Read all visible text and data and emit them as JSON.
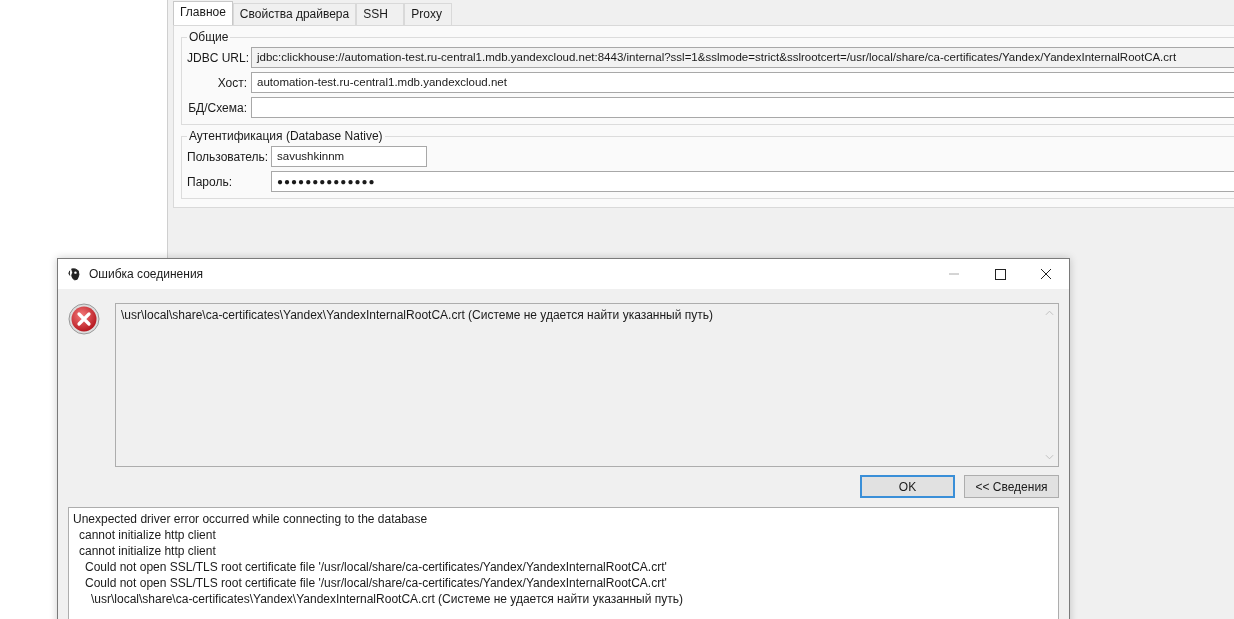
{
  "tabs": [
    {
      "label": "Главное",
      "selected": true
    },
    {
      "label": "Свойства драйвера",
      "selected": false
    },
    {
      "label": "SSH",
      "selected": false
    },
    {
      "label": "Proxy",
      "selected": false
    }
  ],
  "general": {
    "title": "Общие",
    "fields": [
      {
        "label": "JDBC URL:",
        "value": "jdbc:clickhouse://automation-test.ru-central1.mdb.yandexcloud.net:8443/internal?ssl=1&sslmode=strict&sslrootcert=/usr/local/share/ca-certificates/Yandex/YandexInternalRootCA.crt",
        "readonly": true
      },
      {
        "label": "Хост:",
        "value": "automation-test.ru-central1.mdb.yandexcloud.net",
        "readonly": false
      },
      {
        "label": "БД/Схема:",
        "readonly": false
      }
    ]
  },
  "auth": {
    "title": "Аутентификация (Database Native)",
    "user": {
      "label": "Пользователь:",
      "value": "savushkinnm"
    },
    "password": {
      "label": "Пароль:",
      "value": "●●●●●●●●●●●●●●"
    }
  },
  "dialog": {
    "title": "Ошибка соединения",
    "message": "\\usr\\local\\share\\ca-certificates\\Yandex\\YandexInternalRootCA.crt (Системе не удается найти указанный путь)",
    "buttons": [
      {
        "label": "OK",
        "default": true
      },
      {
        "label": "<< Сведения",
        "default": false
      }
    ],
    "details": [
      {
        "text": "Unexpected driver error occurred while connecting to the database",
        "children": [
          {
            "text": "cannot initialize http client"
          },
          {
            "text": "cannot initialize http client",
            "children": [
              {
                "text": "Could not open SSL/TLS root certificate file '/usr/local/share/ca-certificates/Yandex/YandexInternalRootCA.crt'"
              },
              {
                "text": "Could not open SSL/TLS root certificate file '/usr/local/share/ca-certificates/Yandex/YandexInternalRootCA.crt'",
                "children": [
                  {
                    "text": "\\usr\\local\\share\\ca-certificates\\Yandex\\YandexInternalRootCA.crt (Системе не удается найти указанный путь)"
                  }
                ]
              }
            ]
          }
        ]
      }
    ]
  }
}
